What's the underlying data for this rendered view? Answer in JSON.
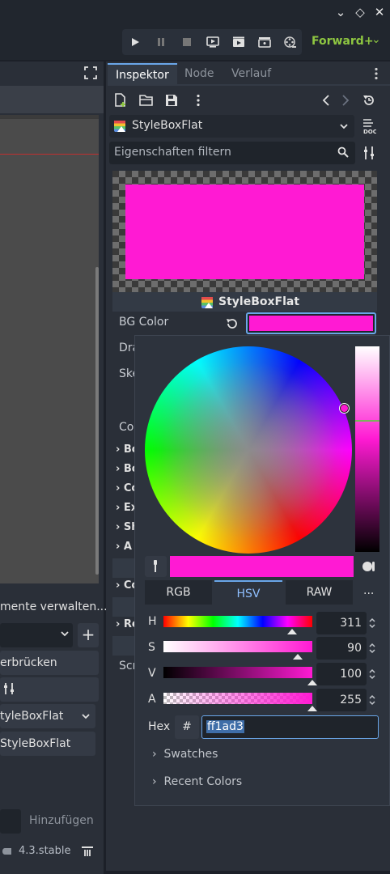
{
  "titlebar": {
    "minimize": "⌄",
    "restore": "◇",
    "close": "✕"
  },
  "toolbar": {
    "renderer": "Forward+",
    "renderer_chevron": "⌄"
  },
  "left": {
    "manage_label": "mente verwalten...",
    "add_icon": "+",
    "bridge_label": "erbrücken",
    "type_label": "tyleBoxFlat",
    "type_label2": "StyleBoxFlat",
    "add_button": "Hinzufügen",
    "version": "4.3.stable"
  },
  "inspector": {
    "tabs": [
      {
        "label": "Inspektor"
      },
      {
        "label": "Node"
      },
      {
        "label": "Verlauf"
      }
    ],
    "resource_name": "StyleBoxFlat",
    "filter_placeholder": "Eigenschaften filtern",
    "preview_caption": "StyleBoxFlat",
    "properties": {
      "bg_color": "BG Color",
      "draw_center_partial": "Dra",
      "skew_partial": "Ske",
      "corner_partial": "Cor",
      "groups": [
        "Bo",
        "Bo",
        "Co",
        "Ex",
        "Sh",
        "A",
        "Co",
        "Re"
      ],
      "script_partial": "Scr"
    },
    "accent_color": "#ff1ad3"
  },
  "color_picker": {
    "modes": [
      "RGB",
      "HSV",
      "RAW"
    ],
    "active_mode": "HSV",
    "more": "...",
    "sliders": [
      {
        "label": "H",
        "value": "311",
        "fraction": 0.864
      },
      {
        "label": "S",
        "value": "90",
        "fraction": 0.9
      },
      {
        "label": "V",
        "value": "100",
        "fraction": 1.0
      },
      {
        "label": "A",
        "value": "255",
        "fraction": 1.0
      }
    ],
    "hex_label": "Hex",
    "hex_hash": "#",
    "hex_value": "ff1ad3",
    "swatches": "Swatches",
    "recent_colors": "Recent Colors",
    "current_color": "#ff1ad3"
  }
}
